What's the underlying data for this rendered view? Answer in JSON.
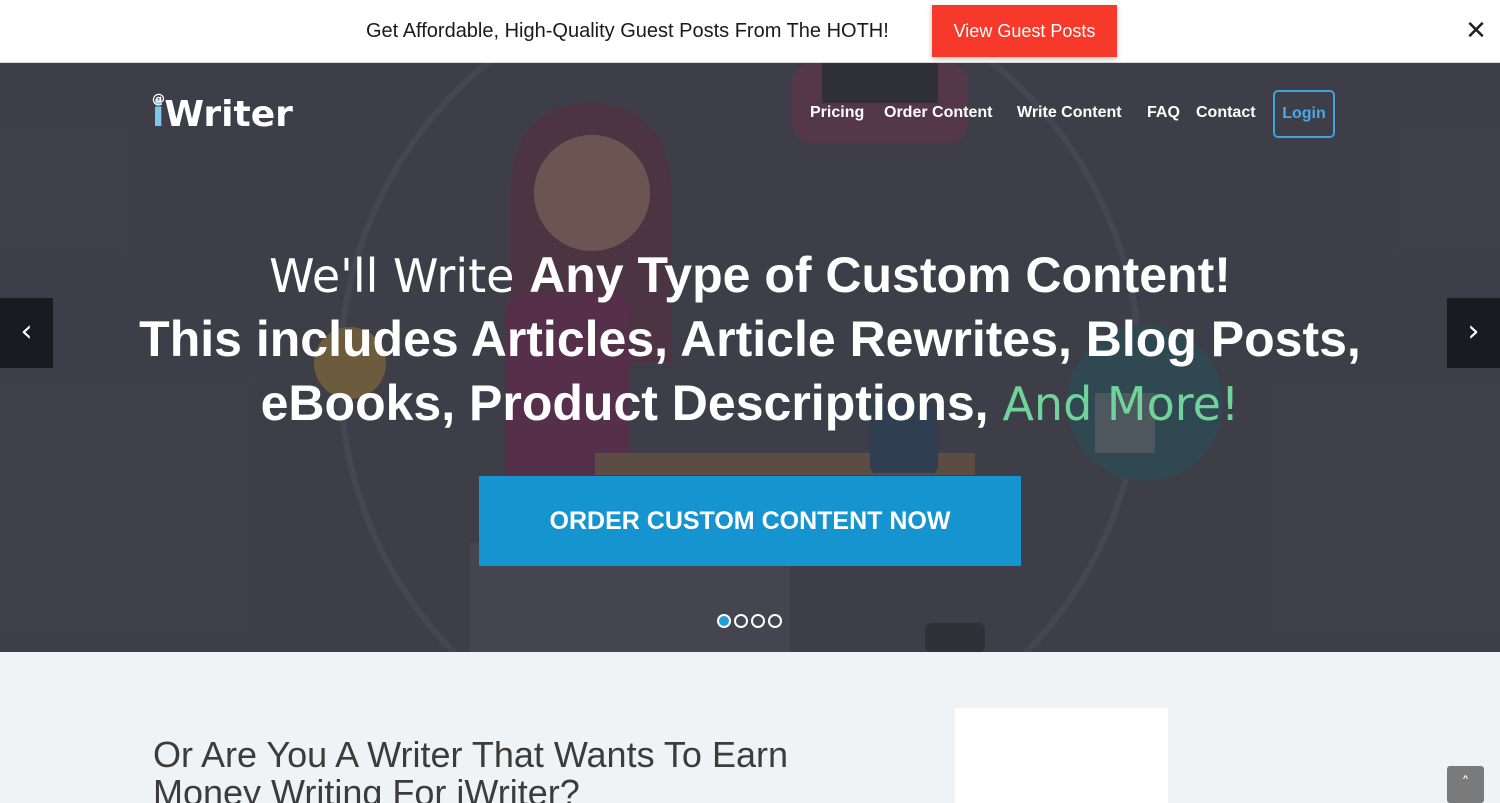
{
  "promo": {
    "text": "Get Affordable, High-Quality Guest Posts From The HOTH!",
    "button_label": "View Guest Posts",
    "close_glyph": "✕",
    "button_color": "#f6392b"
  },
  "header": {
    "logo_at": "@",
    "logo_i": "i",
    "logo_rest": "Writer",
    "nav": [
      "Pricing",
      "Order Content",
      "Write Content",
      "FAQ",
      "Contact"
    ],
    "login_label": "Login"
  },
  "hero": {
    "line1_light": "We'll Write ",
    "line1_bold": "Any Type of Custom Content!",
    "line2": "This includes Articles, Article Rewrites, Blog Posts,",
    "line3_bold": "eBooks, Product Descriptions, ",
    "line3_green": "And More!",
    "cta_label": "ORDER CUSTOM CONTENT NOW",
    "prev_glyph": "‹",
    "next_glyph": "›",
    "slide_count": 4,
    "active_slide": 1,
    "accent_color": "#1594cf",
    "highlight_color": "#6fd39b"
  },
  "lower": {
    "heading_line1": "Or Are You A Writer That Wants To Earn",
    "heading_line2": "Money Writing For iWriter?",
    "scroll_top_glyph": "˄"
  }
}
